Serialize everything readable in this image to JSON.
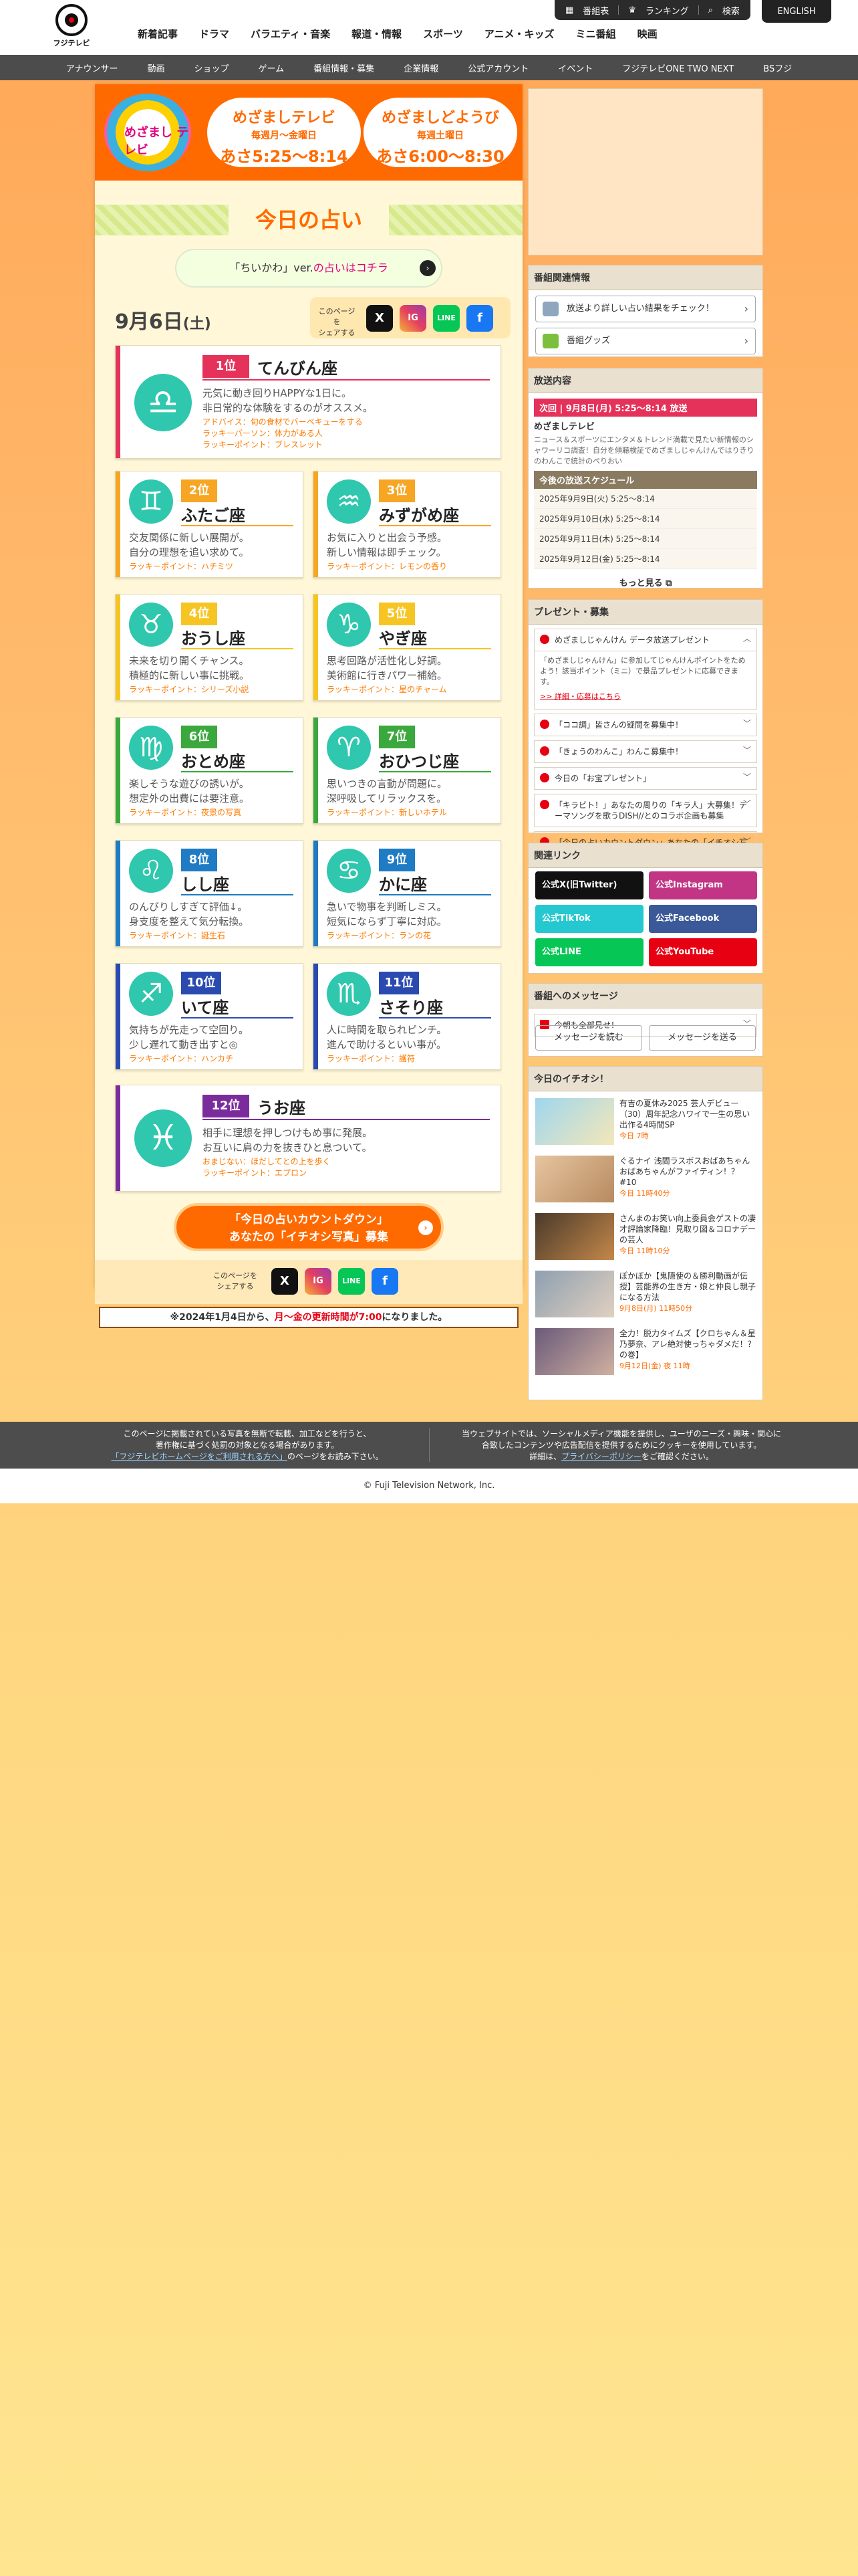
{
  "header": {
    "logo_text": "フジテレビ",
    "util": [
      "番組表",
      "ランキング",
      "検索"
    ],
    "english": "ENGLISH",
    "gnav": [
      "新着記事",
      "ドラマ",
      "バラエティ・音楽",
      "報道・情報",
      "スポーツ",
      "アニメ・キッズ",
      "ミニ番組",
      "映画"
    ],
    "subnav": [
      "アナウンサー",
      "動画",
      "ショップ",
      "ゲーム",
      "番組情報・募集",
      "企業情報",
      "公式アカウント",
      "イベント",
      "フジテレビONE TWO NEXT",
      "BSフジ"
    ]
  },
  "banner": {
    "logo_text": "めざまし テレビ",
    "left": {
      "title": "めざましテレビ",
      "days": "毎週月〜金曜日",
      "time": "あさ5:25〜8:14"
    },
    "right": {
      "title": "めざましどようび",
      "days": "毎週土曜日",
      "time": "あさ6:00〜8:30"
    }
  },
  "page_title": "今日の占い",
  "chiikawa": {
    "prefix": "「ちいかわ」ver.",
    "link": "の占いはコチラ"
  },
  "date": {
    "day": "9月6日",
    "weekday": "(土)"
  },
  "share": {
    "label_line1": "このページを",
    "label_line2": "シェアする",
    "buttons": [
      "X",
      "IG",
      "LINE",
      "f"
    ]
  },
  "cards": [
    {
      "rank": "1位",
      "sign": "てんびん座",
      "symbol": "♎",
      "desc1": "元気に動き回りHAPPYな1日に。",
      "desc2": "非日常的な体験をするのがオススメ。",
      "advice": "アドバイス：旬の食材でバーベキューをする",
      "person": "ラッキーパーソン：体力がある人",
      "lucky": "ラッキーポイント：ブレスレット",
      "color": "#e5325a"
    },
    {
      "rank": "2位",
      "sign": "ふたご座",
      "symbol": "♊",
      "desc1": "交友関係に新しい展開が。",
      "desc2": "自分の理想を追い求めて。",
      "lucky": "ラッキーポイント：ハチミツ",
      "color": "#f6a623"
    },
    {
      "rank": "3位",
      "sign": "みずがめ座",
      "symbol": "♒",
      "desc1": "お気に入りと出会う予感。",
      "desc2": "新しい情報は即チェック。",
      "lucky": "ラッキーポイント：レモンの香り",
      "color": "#f6a623"
    },
    {
      "rank": "4位",
      "sign": "おうし座",
      "symbol": "♉",
      "desc1": "未来を切り開くチャンス。",
      "desc2": "積極的に新しい事に挑戦。",
      "lucky": "ラッキーポイント：シリーズ小説",
      "color": "#f6c523"
    },
    {
      "rank": "5位",
      "sign": "やぎ座",
      "symbol": "♑",
      "desc1": "思考回路が活性化し好調。",
      "desc2": "美術館に行きパワー補給。",
      "lucky": "ラッキーポイント：星のチャーム",
      "color": "#f6c523"
    },
    {
      "rank": "6位",
      "sign": "おとめ座",
      "symbol": "♍",
      "desc1": "楽しそうな遊びの誘いが。",
      "desc2": "想定外の出費には要注意。",
      "lucky": "ラッキーポイント：夜景の写真",
      "color": "#3aa83c"
    },
    {
      "rank": "7位",
      "sign": "おひつじ座",
      "symbol": "♈",
      "desc1": "思いつきの言動が問題に。",
      "desc2": "深呼吸してリラックスを。",
      "lucky": "ラッキーポイント：新しいホテル",
      "color": "#3aa83c"
    },
    {
      "rank": "8位",
      "sign": "しし座",
      "symbol": "♌",
      "desc1": "のんびりしすぎて評価↓。",
      "desc2": "身支度を整えて気分転換。",
      "lucky": "ラッキーポイント：誕生石",
      "color": "#1e7bc4"
    },
    {
      "rank": "9位",
      "sign": "かに座",
      "symbol": "♋",
      "desc1": "急いで物事を判断しミス。",
      "desc2": "短気にならず丁寧に対応。",
      "lucky": "ラッキーポイント：ランの花",
      "color": "#1e7bc4"
    },
    {
      "rank": "10位",
      "sign": "いて座",
      "symbol": "♐",
      "desc1": "気持ちが先走って空回り。",
      "desc2": "少し遅れて動き出すと◎",
      "lucky": "ラッキーポイント：ハンカチ",
      "color": "#2a4ab0"
    },
    {
      "rank": "11位",
      "sign": "さそり座",
      "symbol": "♏",
      "desc1": "人に時間を取られピンチ。",
      "desc2": "進んで助けるといい事が。",
      "lucky": "ラッキーポイント：護符",
      "color": "#2a4ab0"
    },
    {
      "rank": "12位",
      "sign": "うお座",
      "symbol": "♓",
      "desc1": "相手に理想を押しつけもめ事に発展。",
      "desc2": "お互いに肩の力を抜きひと息ついて。",
      "advice": "おまじない：ほだしてとの上を歩く",
      "lucky": "ラッキーポイント：エプロン",
      "color": "#7b2c9c"
    }
  ],
  "countdown": {
    "line1": "「今日の占いカウントダウン」",
    "line2": "あなたの「イチオシ写真」募集"
  },
  "notice": {
    "pre": "※2024年1月4日から、",
    "mid": "月〜金の更新時間が7:00",
    "post": "になりました。"
  },
  "sidebar": {
    "related_title": "番組関連情報",
    "related": [
      "放送より詳しい占い結果をチェック！",
      "番組グッズ"
    ],
    "onair_title": "放送内容",
    "next": "次回 | 9月8日(月) 5:25〜8:14 放送",
    "program": "めざましテレビ",
    "program_desc": "ニュース＆スポーツにエンタメ＆トレンド満載で見たい新情報のシャワーリコ調査！自分を傾聴検証でめざましじゃんけんではりきりのわんこで統計のぺりおい",
    "sched_title": "今後の放送スケジュール",
    "sched": [
      "2025年9月9日(火) 5:25〜8:14",
      "2025年9月10日(水) 5:25〜8:14",
      "2025年9月11日(木) 5:25〜8:14",
      "2025年9月12日(金) 5:25〜8:14"
    ],
    "more": "もっと見る",
    "present_title": "プレゼント・募集",
    "present_open": "めざましじゃんけん データ放送プレゼント",
    "present_body": "「めざましじゃんけん」に参加してじゃんけんポイントをためよう！該当ポイント（ミニ）で景品プレゼントに応募できます。",
    "present_link": ">> 詳細・応募はこちら",
    "presents": [
      "「ココ調」皆さんの疑問を募集中！",
      "「きょうのわんこ」わんこ募集中！",
      "今日の「お宝プレゼント」",
      "「キラビト！」あなたの周りの「キラ人」大募集！テーマソングを歌うDISH//とのコラボ企画も募集",
      "「今日の占いカウントダウン」あなたの「イチオシ写真」募集"
    ],
    "links_title": "関連リンク",
    "socials": [
      "公式X(旧Twitter)",
      "公式Instagram",
      "公式TikTok",
      "公式Facebook",
      "公式LINE",
      "公式YouTube"
    ],
    "msg_title": "番組へのメッセージ",
    "msg_today": "今朝も全部見せ！",
    "msg_read": "メッセージを読む",
    "msg_send": "メッセージを送る",
    "pick_title": "今日のイチオシ！",
    "picks": [
      {
        "text": "有吉の夏休み2025 芸人デビュー（30）周年記念ハワイで一生の思い出作る4時間SP",
        "time": "今日 7時"
      },
      {
        "text": "ぐるナイ 浅間ラスボスおばあちゃん おばあちゃんがファイティン！？ #10",
        "time": "今日 11時40分"
      },
      {
        "text": "さんまのお笑い向上委員会ゲストの凄才評論家降臨！見取り図＆コロナデーの芸人",
        "time": "今日 11時10分"
      },
      {
        "text": "ぽかぼか【鬼隠使の＆勝利動画が伝授】芸能界の生き方・娘と仲良し親子になる方法",
        "time": "9月8日(月) 11時50分"
      },
      {
        "text": "全力！脱力タイムズ【クロちゃん＆星乃夢奈、アレ絶対使っちゃダメだ！？の巻】",
        "time": "9月12日(金) 夜 11時"
      }
    ]
  },
  "footer": {
    "left1": "このページに掲載されている写真を無断で転載、加工などを行うと、",
    "left2": "著作権に基づく処罰の対象となる場合があります。",
    "left_link": "「フジテレビホームページをご利用される方へ」",
    "left3": "のページをお読み下さい。",
    "right1": "当ウェブサイトでは、ソーシャルメディア機能を提供し、ユーザのニーズ・興味・関心に",
    "right2": "合致したコンテンツや広告配信を提供するためにクッキーを使用しています。",
    "right_pre": "詳細は、",
    "right_link": "プライバシーポリシー",
    "right_post": "をご確認ください。",
    "copyright": "© Fuji Television Network, Inc."
  }
}
